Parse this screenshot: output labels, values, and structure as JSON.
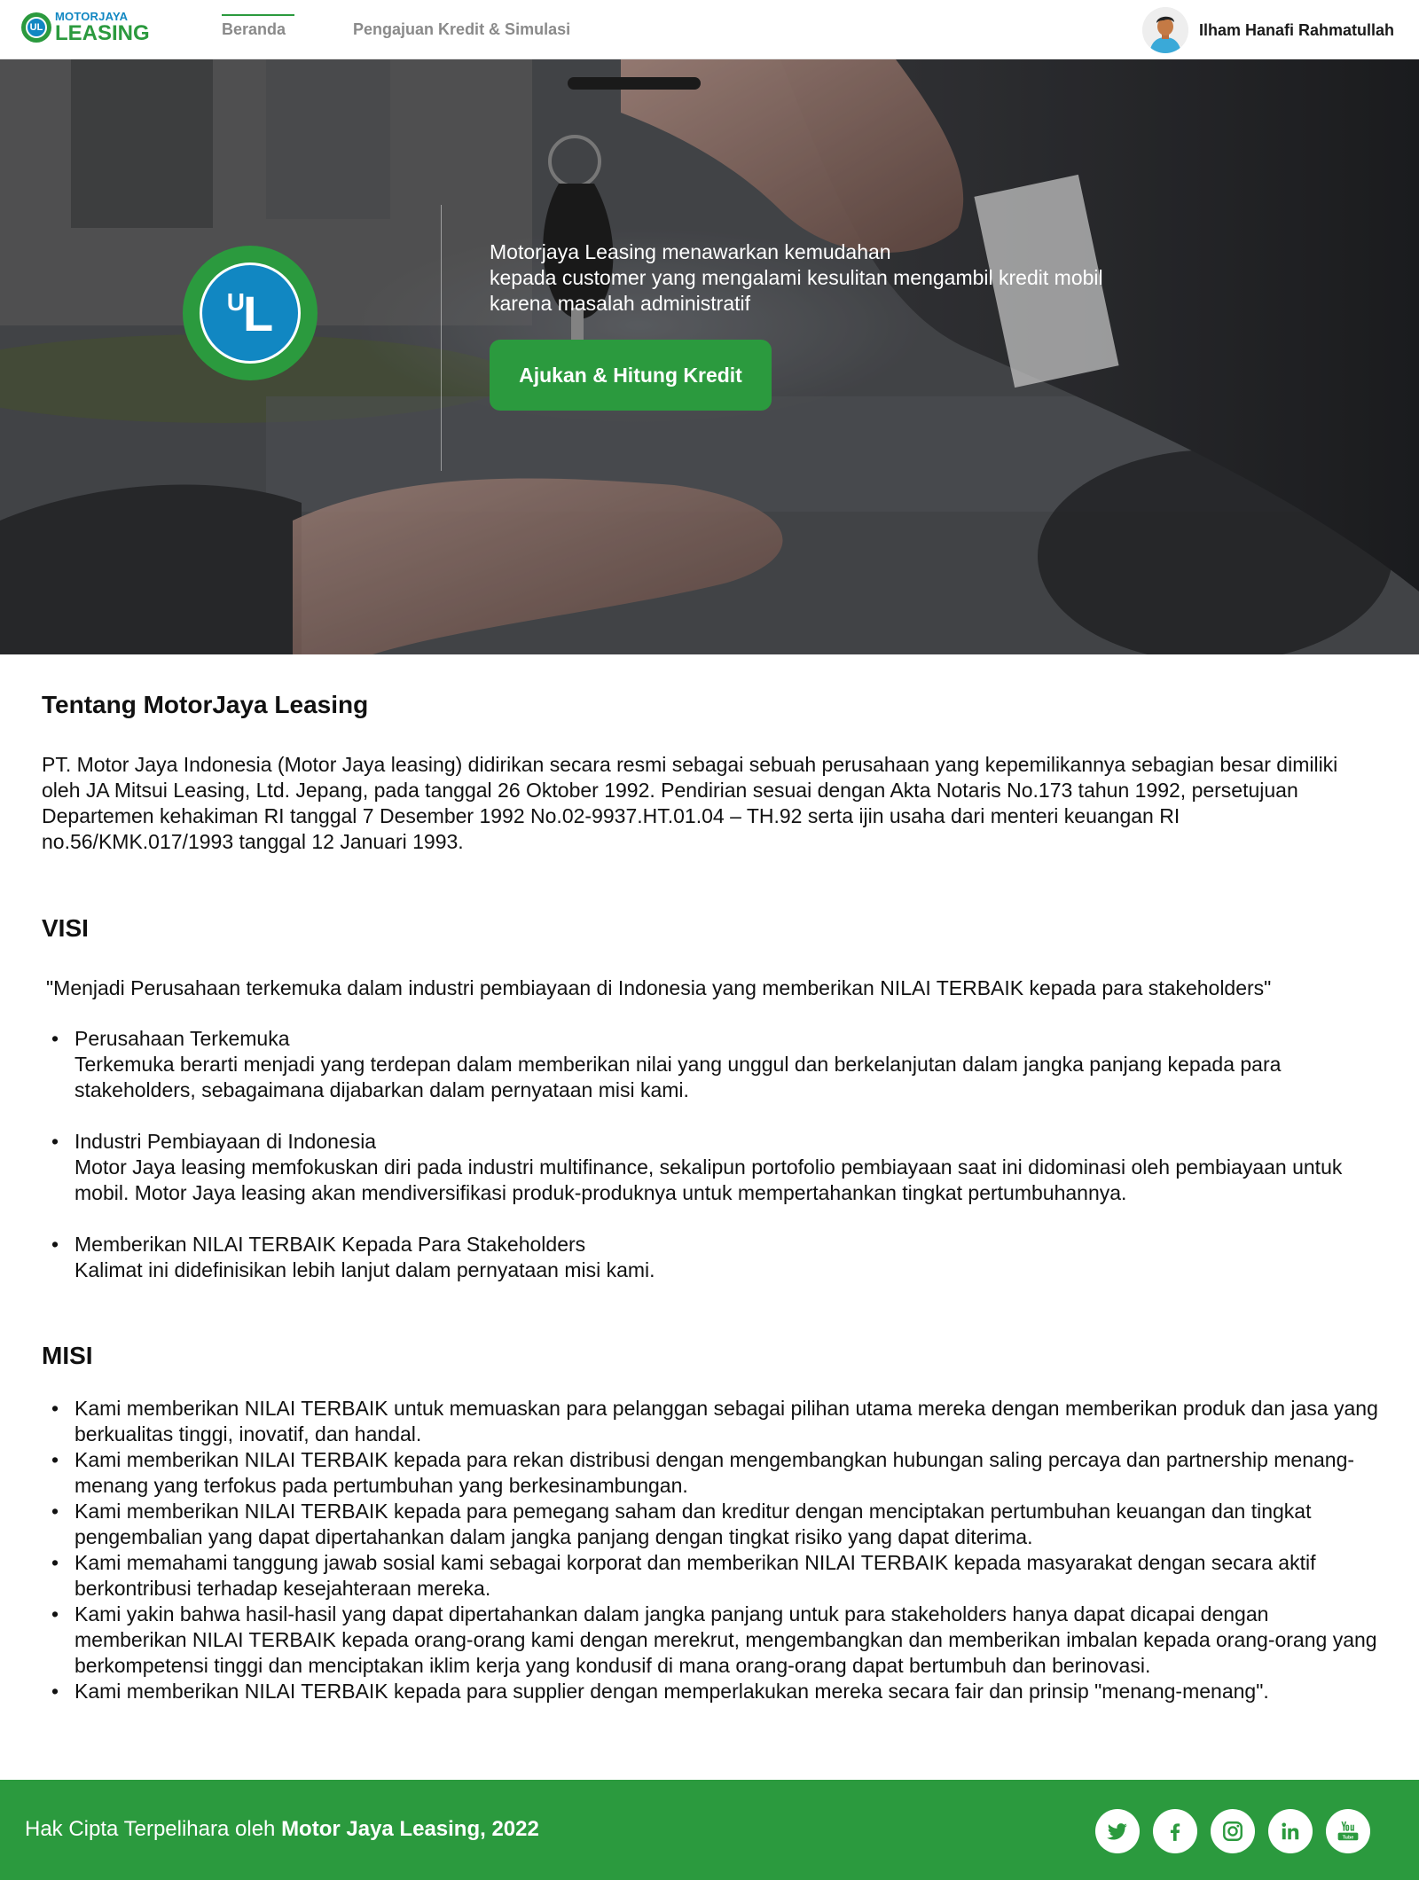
{
  "brand": {
    "top": "MOTORJAYA",
    "bottom": "LEASING",
    "mark": "UL"
  },
  "nav": [
    {
      "label": "Beranda",
      "active": true
    },
    {
      "label": "Pengajuan Kredit & Simulasi",
      "active": false
    }
  ],
  "user": {
    "name": "Ilham Hanafi Rahmatullah",
    "avatar_icon": "user-avatar-icon"
  },
  "hero": {
    "logo_u": "U",
    "logo_l": "L",
    "lines": [
      "Motorjaya Leasing menawarkan kemudahan",
      "kepada customer yang mengalami kesulitan mengambil kredit mobil",
      "karena masalah administratif"
    ],
    "cta": "Ajukan & Hitung Kredit"
  },
  "about": {
    "title": "Tentang MotorJaya Leasing",
    "text": "PT. Motor Jaya Indonesia (Motor Jaya leasing) didirikan secara resmi sebagai sebuah perusahaan yang kepemilikannya sebagian besar dimiliki oleh JA Mitsui Leasing, Ltd. Jepang, pada tanggal 26 Oktober 1992. Pendirian sesuai dengan Akta Notaris No.173 tahun 1992, persetujuan Departemen kehakiman RI tanggal 7 Desember 1992 No.02-9937.HT.01.04 – TH.92 serta ijin usaha dari menteri keuangan RI no.56/KMK.017/1993 tanggal 12 Januari 1993."
  },
  "visi": {
    "title": "VISI",
    "quote": "\"Menjadi Perusahaan terkemuka dalam industri pembiayaan di Indonesia yang memberikan NILAI TERBAIK kepada para stakeholders\"",
    "items": [
      {
        "heading": "Perusahaan Terkemuka",
        "desc": "Terkemuka berarti menjadi yang terdepan dalam memberikan nilai yang unggul dan berkelanjutan dalam jangka panjang kepada para stakeholders, sebagaimana dijabarkan dalam pernyataan misi kami."
      },
      {
        "heading": "Industri Pembiayaan di Indonesia",
        "desc": "Motor Jaya leasing memfokuskan diri pada industri multifinance, sekalipun portofolio pembiayaan saat ini didominasi oleh pembiayaan untuk mobil. Motor Jaya leasing  akan mendiversifikasi produk-produknya untuk mempertahankan tingkat pertumbuhannya."
      },
      {
        "heading": "Memberikan NILAI TERBAIK Kepada Para Stakeholders",
        "desc": "Kalimat ini didefinisikan lebih lanjut dalam pernyataan misi kami."
      }
    ]
  },
  "misi": {
    "title": "MISI",
    "items": [
      "Kami memberikan NILAI TERBAIK untuk memuaskan para pelanggan sebagai pilihan utama mereka dengan memberikan produk dan jasa yang berkualitas tinggi, inovatif, dan handal.",
      "Kami memberikan NILAI TERBAIK kepada para rekan distribusi dengan mengembangkan hubungan saling percaya dan partnership menang-menang yang terfokus pada pertumbuhan yang berkesinambungan.",
      "Kami memberikan NILAI TERBAIK kepada para pemegang saham dan kreditur dengan menciptakan pertumbuhan keuangan dan tingkat pengembalian yang dapat dipertahankan dalam jangka panjang dengan tingkat risiko yang dapat diterima.",
      "Kami memahami tanggung jawab sosial kami sebagai korporat dan memberikan NILAI TERBAIK kepada masyarakat dengan secara aktif berkontribusi terhadap kesejahteraan mereka.",
      "Kami yakin bahwa hasil-hasil yang dapat dipertahankan dalam jangka panjang untuk para stakeholders hanya dapat dicapai dengan memberikan NILAI TERBAIK kepada orang-orang kami dengan merekrut, mengembangkan dan memberikan imbalan kepada orang-orang yang berkompetensi tinggi dan menciptakan iklim kerja yang kondusif di mana orang-orang dapat bertumbuh dan berinovasi.",
      "Kami memberikan NILAI TERBAIK kepada para supplier dengan memperlakukan mereka secara fair dan prinsip \"menang-menang\"."
    ]
  },
  "footer": {
    "prefix": "Hak Cipta Terpelihara oleh ",
    "owner": "Motor Jaya Leasing, 2022",
    "socials": [
      "twitter-icon",
      "facebook-icon",
      "instagram-icon",
      "linkedin-icon",
      "youtube-icon"
    ]
  },
  "colors": {
    "brand_green": "#2b9a3e",
    "brand_blue": "#1187c2"
  }
}
